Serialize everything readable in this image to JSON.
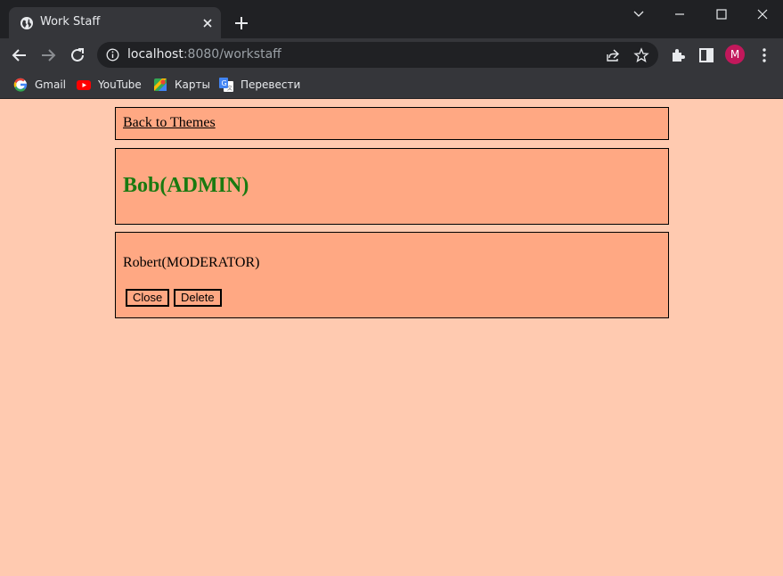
{
  "browser": {
    "tab_title": "Work Staff",
    "url_host": "localhost",
    "url_rest": ":8080/workstaff",
    "profile_initial": "M",
    "bookmarks": [
      {
        "label": "Gmail",
        "icon": "gmail-icon"
      },
      {
        "label": "YouTube",
        "icon": "youtube-icon"
      },
      {
        "label": "Карты",
        "icon": "maps-icon"
      },
      {
        "label": "Перевести",
        "icon": "translate-icon"
      }
    ]
  },
  "page": {
    "back_link": "Back to Themes",
    "admin_heading": "Bob(ADMIN)",
    "staff": [
      {
        "name": "Robert(MODERATOR)",
        "close_label": "Close",
        "delete_label": "Delete"
      }
    ]
  },
  "colors": {
    "page_bg": "#ffcab0",
    "box_bg": "#ffa883",
    "admin_text": "#1a7a10",
    "chrome_dark": "#202124",
    "chrome_tab": "#35363a"
  }
}
